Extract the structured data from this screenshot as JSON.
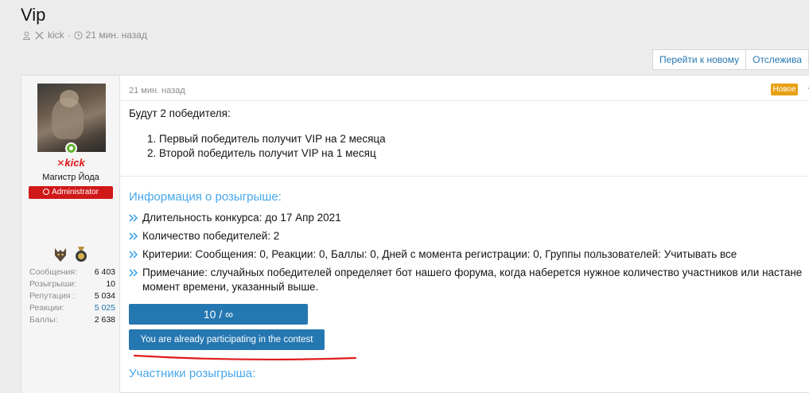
{
  "thread": {
    "title": "Vip",
    "author": "kick",
    "time": "21 мин. назад"
  },
  "toolbar": {
    "goto_new": "Перейти к новому",
    "watch": "Отслежива"
  },
  "user": {
    "name": "kick",
    "title": "Магистр Йода",
    "banner": "Administrator",
    "stats": [
      {
        "label": "Сообщения:",
        "value": "6 403",
        "link": false
      },
      {
        "label": "Розыгрыши:",
        "value": "10",
        "link": false
      },
      {
        "label": "Репутация :",
        "value": "5 034",
        "link": false
      },
      {
        "label": "Реакции:",
        "value": "5 025",
        "link": true
      },
      {
        "label": "Баллы:",
        "value": "2 638",
        "link": false
      }
    ]
  },
  "post": {
    "time": "21 мин. назад",
    "new_badge": "Новое",
    "intro": "Будут 2 победителя:",
    "winners": [
      "1. Первый победитель получит VIP на 2 месяца",
      "2. Второй победитель получит VIP на 1 месяц"
    ],
    "info_heading": "Информация о розыгрыше:",
    "facts": [
      "Длительность конкурса: до 17 Апр 2021",
      "Количество победителей: 2",
      "Критерии: Сообщения: 0, Реакции: 0, Баллы: 0, Дней с момента регистрации: 0, Группы пользователей: Учитывать все",
      "Примечание: случайных победителей определяет бот нашего форума, когда наберется нужное количество участников или настане момент времени, указанный выше."
    ],
    "participants_count": "10 / ∞",
    "join_label": "You are already participating in the contest",
    "participants_heading": "Участники розыгрыша:"
  },
  "colors": {
    "accent": "#2577b1",
    "heading": "#47a7eb",
    "admin": "#d01818",
    "new_badge": "#e8a114",
    "underline": "#e01b1b"
  }
}
